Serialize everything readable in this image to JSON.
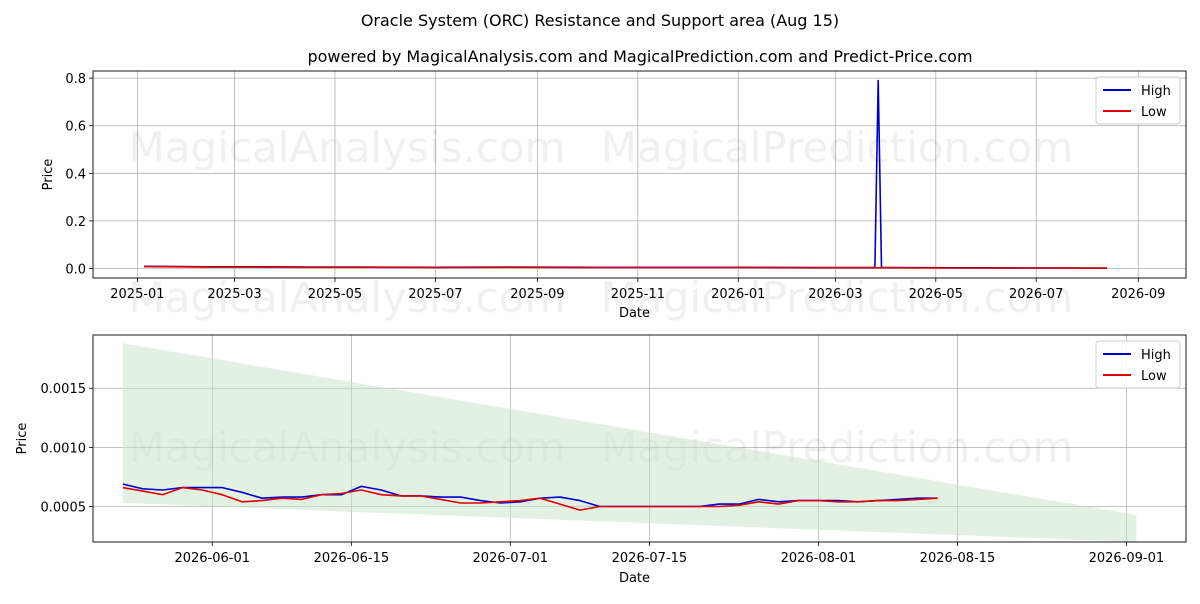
{
  "title": "Oracle System (ORC) Resistance and Support area (Aug 15)",
  "subtitle": "powered by MagicalAnalysis.com and MagicalPrediction.com and Predict-Price.com",
  "watermarks": [
    "MagicalAnalysis.com",
    "MagicalPrediction.com"
  ],
  "colors": {
    "high": "#0000cc",
    "low": "#dd0000",
    "band": "#c8e3c8"
  },
  "chart_data": [
    {
      "type": "line",
      "xlabel": "Date",
      "ylabel": "Price",
      "xlim": [
        "2024-12-05",
        "2026-09-30"
      ],
      "ylim": [
        -0.04,
        0.83
      ],
      "x_ticks": [
        "2025-01",
        "2025-03",
        "2025-05",
        "2025-07",
        "2025-09",
        "2025-11",
        "2026-01",
        "2026-03",
        "2026-05",
        "2026-07",
        "2026-09"
      ],
      "y_ticks": [
        0.0,
        0.2,
        0.4,
        0.6,
        0.8
      ],
      "y_tick_labels": [
        "0.0",
        "0.2",
        "0.4",
        "0.6",
        "0.8"
      ],
      "grid": true,
      "legend": "top-right",
      "series": [
        {
          "name": "High",
          "color": "#0000cc",
          "points": [
            [
              "2025-01-05",
              0.009
            ],
            [
              "2025-02-15",
              0.007
            ],
            [
              "2025-03-15",
              0.007
            ],
            [
              "2025-04-15",
              0.006
            ],
            [
              "2025-05-15",
              0.006
            ],
            [
              "2025-07-01",
              0.005
            ],
            [
              "2025-08-15",
              0.006
            ],
            [
              "2025-10-01",
              0.005
            ],
            [
              "2025-11-15",
              0.005
            ],
            [
              "2026-01-01",
              0.005
            ],
            [
              "2026-02-15",
              0.004
            ],
            [
              "2026-03-20",
              0.004
            ],
            [
              "2026-03-25",
              0.004
            ],
            [
              "2026-03-27",
              0.79
            ],
            [
              "2026-03-29",
              0.004
            ],
            [
              "2026-05-15",
              0.003
            ],
            [
              "2026-07-01",
              0.002
            ],
            [
              "2026-08-13",
              0.002
            ]
          ]
        },
        {
          "name": "Low",
          "color": "#dd0000",
          "points": [
            [
              "2025-01-05",
              0.008
            ],
            [
              "2025-02-15",
              0.006
            ],
            [
              "2025-03-15",
              0.006
            ],
            [
              "2025-04-15",
              0.005
            ],
            [
              "2025-05-15",
              0.005
            ],
            [
              "2025-07-01",
              0.004
            ],
            [
              "2025-08-15",
              0.005
            ],
            [
              "2025-10-01",
              0.004
            ],
            [
              "2025-11-15",
              0.004
            ],
            [
              "2026-01-01",
              0.004
            ],
            [
              "2026-02-15",
              0.003
            ],
            [
              "2026-03-25",
              0.003
            ],
            [
              "2026-05-15",
              0.002
            ],
            [
              "2026-07-01",
              0.002
            ],
            [
              "2026-08-13",
              0.001
            ]
          ]
        }
      ]
    },
    {
      "type": "line",
      "xlabel": "Date",
      "ylabel": "Price",
      "xlim": [
        "2026-05-20",
        "2026-09-07"
      ],
      "ylim": [
        0.0002,
        0.00195
      ],
      "x_ticks": [
        "2026-06-01",
        "2026-06-15",
        "2026-07-01",
        "2026-07-15",
        "2026-08-01",
        "2026-08-15",
        "2026-09-01"
      ],
      "y_ticks": [
        0.0005,
        0.001,
        0.0015
      ],
      "y_tick_labels": [
        "0.0005",
        "0.0010",
        "0.0015"
      ],
      "grid": true,
      "legend": "top-right",
      "band": {
        "x": [
          "2026-05-23",
          "2026-09-02"
        ],
        "upper": [
          0.00188,
          0.00043
        ],
        "lower": [
          0.00053,
          0.0002
        ]
      },
      "series": [
        {
          "name": "High",
          "color": "#0000cc",
          "x": [
            "2026-05-23",
            "2026-05-25",
            "2026-05-27",
            "2026-05-29",
            "2026-05-31",
            "2026-06-02",
            "2026-06-04",
            "2026-06-06",
            "2026-06-08",
            "2026-06-10",
            "2026-06-12",
            "2026-06-14",
            "2026-06-16",
            "2026-06-18",
            "2026-06-20",
            "2026-06-22",
            "2026-06-24",
            "2026-06-26",
            "2026-06-28",
            "2026-06-30",
            "2026-07-02",
            "2026-07-04",
            "2026-07-06",
            "2026-07-08",
            "2026-07-10",
            "2026-07-12",
            "2026-07-14",
            "2026-07-16",
            "2026-07-18",
            "2026-07-20",
            "2026-07-22",
            "2026-07-24",
            "2026-07-26",
            "2026-07-28",
            "2026-07-30",
            "2026-08-01",
            "2026-08-03",
            "2026-08-05",
            "2026-08-07",
            "2026-08-09",
            "2026-08-11",
            "2026-08-13"
          ],
          "values": [
            0.00069,
            0.00065,
            0.00064,
            0.00066,
            0.00066,
            0.00066,
            0.00062,
            0.00057,
            0.00058,
            0.00058,
            0.0006,
            0.0006,
            0.00067,
            0.00064,
            0.00059,
            0.00059,
            0.00058,
            0.00058,
            0.00055,
            0.00053,
            0.00054,
            0.00057,
            0.00058,
            0.00055,
            0.0005,
            0.0005,
            0.0005,
            0.0005,
            0.0005,
            0.0005,
            0.00052,
            0.00052,
            0.00056,
            0.00054,
            0.00055,
            0.00055,
            0.00055,
            0.00054,
            0.00055,
            0.00056,
            0.00057,
            0.00057
          ]
        },
        {
          "name": "Low",
          "color": "#dd0000",
          "x": [
            "2026-05-23",
            "2026-05-25",
            "2026-05-27",
            "2026-05-29",
            "2026-05-31",
            "2026-06-02",
            "2026-06-04",
            "2026-06-06",
            "2026-06-08",
            "2026-06-10",
            "2026-06-12",
            "2026-06-14",
            "2026-06-16",
            "2026-06-18",
            "2026-06-20",
            "2026-06-22",
            "2026-06-24",
            "2026-06-26",
            "2026-06-28",
            "2026-06-30",
            "2026-07-02",
            "2026-07-04",
            "2026-07-06",
            "2026-07-08",
            "2026-07-10",
            "2026-07-12",
            "2026-07-14",
            "2026-07-16",
            "2026-07-18",
            "2026-07-20",
            "2026-07-22",
            "2026-07-24",
            "2026-07-26",
            "2026-07-28",
            "2026-07-30",
            "2026-08-01",
            "2026-08-03",
            "2026-08-05",
            "2026-08-07",
            "2026-08-09",
            "2026-08-11",
            "2026-08-13"
          ],
          "values": [
            0.00066,
            0.00063,
            0.0006,
            0.00066,
            0.00064,
            0.0006,
            0.00054,
            0.00055,
            0.00057,
            0.00056,
            0.0006,
            0.00061,
            0.00064,
            0.0006,
            0.00059,
            0.00059,
            0.00056,
            0.00053,
            0.00053,
            0.00054,
            0.00055,
            0.00057,
            0.00052,
            0.00047,
            0.0005,
            0.0005,
            0.0005,
            0.0005,
            0.0005,
            0.0005,
            0.0005,
            0.00051,
            0.00054,
            0.00052,
            0.00055,
            0.00055,
            0.00054,
            0.00054,
            0.00055,
            0.00055,
            0.00056,
            0.00057
          ]
        }
      ]
    }
  ]
}
